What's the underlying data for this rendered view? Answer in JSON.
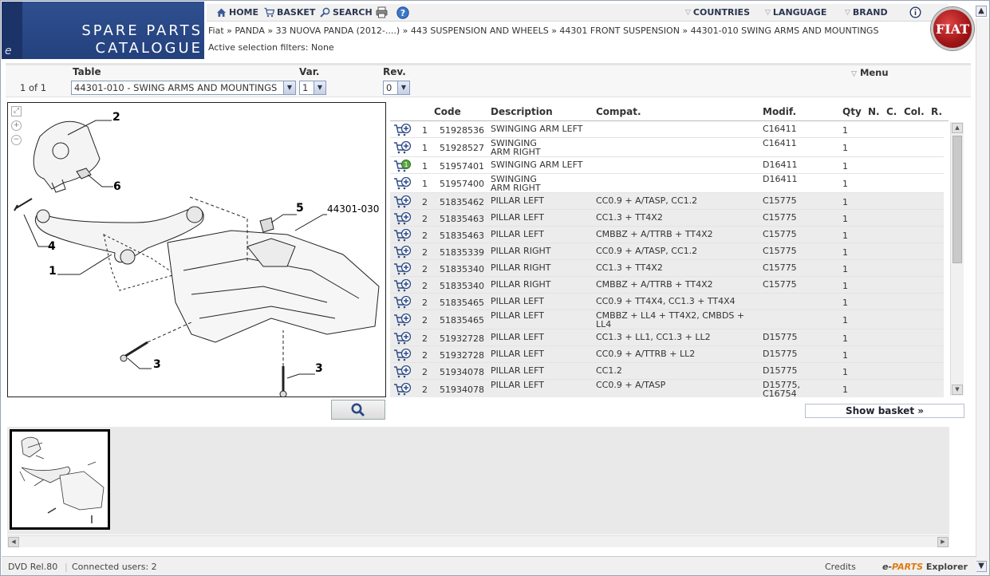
{
  "header": {
    "title_line1": "SPARE PARTS",
    "title_line2": "CATALOGUE",
    "side_letter": "e",
    "nav": [
      {
        "label": "HOME",
        "icon": "home-icon"
      },
      {
        "label": "BASKET",
        "icon": "cart-icon"
      },
      {
        "label": "SEARCH",
        "icon": "search-icon"
      }
    ],
    "right_nav": [
      "COUNTRIES",
      "LANGUAGE",
      "BRAND"
    ],
    "brand_logo": "FIAT",
    "breadcrumb": "Fiat » PANDA » 33 NUOVA PANDA (2012-....) » 443 SUSPENSION AND WHEELS » 44301 FRONT SUSPENSION » 44301-010 SWING ARMS AND MOUNTINGS",
    "filters": "Active selection filters: None"
  },
  "selector": {
    "table_label": "Table",
    "var_label": "Var.",
    "rev_label": "Rev.",
    "page": "1 of 1",
    "table_value": "44301-010 - SWING ARMS AND MOUNTINGS",
    "var_value": "1",
    "rev_value": "0",
    "menu_label": "Menu"
  },
  "drawing": {
    "callouts": [
      "2",
      "6",
      "4",
      "1",
      "5",
      "3",
      "3"
    ],
    "reference": "44301-030"
  },
  "table": {
    "columns": [
      "Code",
      "Description",
      "Compat.",
      "Modif.",
      "Qty",
      "N.",
      "C.",
      "Col.",
      "R."
    ],
    "rows": [
      {
        "ref": "1",
        "code": "51928536",
        "desc": "SWINGING ARM LEFT",
        "desc2": "",
        "compat": "",
        "compat2": "",
        "modif": "C16411",
        "modif2": "",
        "qty": "1",
        "alt": false,
        "badge": false
      },
      {
        "ref": "1",
        "code": "51928527",
        "desc": "SWINGING",
        "desc2": "ARM RIGHT",
        "compat": "",
        "compat2": "",
        "modif": "C16411",
        "modif2": "",
        "qty": "1",
        "alt": false,
        "badge": false
      },
      {
        "ref": "1",
        "code": "51957401",
        "desc": "SWINGING ARM LEFT",
        "desc2": "",
        "compat": "",
        "compat2": "",
        "modif": "D16411",
        "modif2": "",
        "qty": "1",
        "alt": false,
        "badge": true
      },
      {
        "ref": "1",
        "code": "51957400",
        "desc": "SWINGING",
        "desc2": "ARM RIGHT",
        "compat": "",
        "compat2": "",
        "modif": "D16411",
        "modif2": "",
        "qty": "1",
        "alt": false,
        "badge": false
      },
      {
        "ref": "2",
        "code": "51835462",
        "desc": "PILLAR LEFT",
        "desc2": "",
        "compat": "CC0.9 + A/TASP, CC1.2",
        "compat2": "",
        "modif": "C15775",
        "modif2": "",
        "qty": "1",
        "alt": true,
        "badge": false
      },
      {
        "ref": "2",
        "code": "51835463",
        "desc": "PILLAR LEFT",
        "desc2": "",
        "compat": "CC1.3 + TT4X2",
        "compat2": "",
        "modif": "C15775",
        "modif2": "",
        "qty": "1",
        "alt": true,
        "badge": false
      },
      {
        "ref": "2",
        "code": "51835463",
        "desc": "PILLAR LEFT",
        "desc2": "",
        "compat": "CMBBZ + A/TTRB + TT4X2",
        "compat2": "",
        "modif": "C15775",
        "modif2": "",
        "qty": "1",
        "alt": true,
        "badge": false
      },
      {
        "ref": "2",
        "code": "51835339",
        "desc": "PILLAR RIGHT",
        "desc2": "",
        "compat": "CC0.9 + A/TASP, CC1.2",
        "compat2": "",
        "modif": "C15775",
        "modif2": "",
        "qty": "1",
        "alt": true,
        "badge": false
      },
      {
        "ref": "2",
        "code": "51835340",
        "desc": "PILLAR RIGHT",
        "desc2": "",
        "compat": "CC1.3 + TT4X2",
        "compat2": "",
        "modif": "C15775",
        "modif2": "",
        "qty": "1",
        "alt": true,
        "badge": false
      },
      {
        "ref": "2",
        "code": "51835340",
        "desc": "PILLAR RIGHT",
        "desc2": "",
        "compat": "CMBBZ + A/TTRB + TT4X2",
        "compat2": "",
        "modif": "C15775",
        "modif2": "",
        "qty": "1",
        "alt": true,
        "badge": false
      },
      {
        "ref": "2",
        "code": "51835465",
        "desc": "PILLAR LEFT",
        "desc2": "",
        "compat": "CC0.9 + TT4X4, CC1.3 + TT4X4",
        "compat2": "",
        "modif": "",
        "modif2": "",
        "qty": "1",
        "alt": true,
        "badge": false
      },
      {
        "ref": "2",
        "code": "51835465",
        "desc": "PILLAR LEFT",
        "desc2": "",
        "compat": "CMBBZ + LL4 + TT4X2, CMBDS +",
        "compat2": "LL4",
        "modif": "",
        "modif2": "",
        "qty": "1",
        "alt": true,
        "badge": false
      },
      {
        "ref": "2",
        "code": "51932728",
        "desc": "PILLAR LEFT",
        "desc2": "",
        "compat": "CC1.3 + LL1, CC1.3 + LL2",
        "compat2": "",
        "modif": "D15775",
        "modif2": "",
        "qty": "1",
        "alt": true,
        "badge": false
      },
      {
        "ref": "2",
        "code": "51932728",
        "desc": "PILLAR LEFT",
        "desc2": "",
        "compat": "CC0.9 + A/TTRB + LL2",
        "compat2": "",
        "modif": "D15775",
        "modif2": "",
        "qty": "1",
        "alt": true,
        "badge": false
      },
      {
        "ref": "2",
        "code": "51934078",
        "desc": "PILLAR LEFT",
        "desc2": "",
        "compat": "CC1.2",
        "compat2": "",
        "modif": "D15775",
        "modif2": "",
        "qty": "1",
        "alt": true,
        "badge": false
      },
      {
        "ref": "2",
        "code": "51934078",
        "desc": "PILLAR LEFT",
        "desc2": "",
        "compat": "CC0.9 + A/TASP",
        "compat2": "",
        "modif": "D15775,",
        "modif2": "C16754",
        "qty": "1",
        "alt": true,
        "badge": false
      }
    ],
    "badge_text": "1"
  },
  "show_basket_label": "Show basket »",
  "status": {
    "release": "DVD Rel.80",
    "users": "Connected users: 2",
    "credits": "Credits",
    "product_a": "e-",
    "product_b": "PARTS",
    "product_c": " Explorer"
  },
  "colors": {
    "header_blue": "#23417d",
    "alt_row": "#ececec",
    "link_dark": "#2b3550"
  }
}
